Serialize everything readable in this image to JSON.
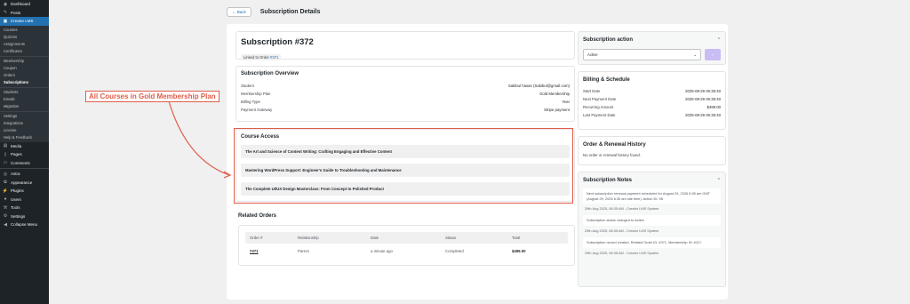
{
  "sidebar": {
    "top": [
      {
        "label": "Dashboard",
        "icon": "dashboard-icon"
      },
      {
        "label": "Posts",
        "icon": "pin-icon"
      },
      {
        "label": "Creator LMS",
        "icon": "lms-icon"
      }
    ],
    "lms_sub": [
      {
        "label": "Courses"
      },
      {
        "label": "Quizzes"
      },
      {
        "label": "Assignments"
      },
      {
        "label": "Certificates"
      },
      {
        "label": "Membership"
      },
      {
        "label": "Coupon"
      },
      {
        "label": "Orders"
      },
      {
        "label": "Subscriptions"
      },
      {
        "label": "Students"
      },
      {
        "label": "Emails"
      },
      {
        "label": "Migration"
      },
      {
        "label": "Settings"
      },
      {
        "label": "Integrations"
      },
      {
        "label": "License"
      },
      {
        "label": "Help & Feedback"
      }
    ],
    "bottom": [
      {
        "label": "Media",
        "icon": "media-icon"
      },
      {
        "label": "Pages",
        "icon": "pages-icon"
      },
      {
        "label": "Comments",
        "icon": "comments-icon"
      },
      {
        "label": "Astra",
        "icon": "astra-icon"
      },
      {
        "label": "Appearance",
        "icon": "appearance-icon"
      },
      {
        "label": "Plugins",
        "icon": "plugins-icon"
      },
      {
        "label": "Users",
        "icon": "users-icon"
      },
      {
        "label": "Tools",
        "icon": "tools-icon"
      },
      {
        "label": "Settings",
        "icon": "settings-icon"
      },
      {
        "label": "Collapse Menu",
        "icon": "collapse-icon"
      }
    ]
  },
  "header": {
    "back": "← Back",
    "title": "Subscription Details"
  },
  "subscription": {
    "title": "Subscription #372",
    "linked_prefix": "Linked to Order",
    "linked_order": "#371"
  },
  "overview": {
    "title": "Subscription Overview",
    "rows": [
      {
        "label": "Student",
        "value": "Sakibul hasan (Sakibul@gmail.com)"
      },
      {
        "label": "Membership Plan",
        "value": "Gold Membership"
      },
      {
        "label": "Billing Type",
        "value": "Year"
      },
      {
        "label": "Payment Gateway",
        "value": "Stripe payment"
      }
    ]
  },
  "course_access": {
    "title": "Course Access",
    "items": [
      "The Art and Science of Content Writing: Crafting Engaging and Effective Content",
      "Mastering WordPress Support: Engineer's Guide to Troubleshooting and Maintenance",
      "The Complete UI/UX Design Masterclass: From Concept to Polished Product"
    ]
  },
  "related_orders": {
    "title": "Related Orders",
    "headers": [
      "Order #",
      "Relationship",
      "Date",
      "Status",
      "Total"
    ],
    "rows": [
      {
        "order": "#371",
        "relationship": "Parent",
        "date": "a minute ago",
        "status": "Completed",
        "total": "$499.00"
      }
    ]
  },
  "subscription_action": {
    "title": "Subscription action",
    "selected": "Active",
    "button_icon": "chevron-right-icon"
  },
  "billing": {
    "title": "Billing & Schedule",
    "rows": [
      {
        "label": "Start Date",
        "value": "2025-08-29 06:35:40"
      },
      {
        "label": "Next Payment Date",
        "value": "2026-08-29 06:35:40"
      },
      {
        "label": "Recurring Amount",
        "value": "$499.00"
      },
      {
        "label": "Last Payment Date",
        "value": "2025-08-29 06:35:40"
      }
    ]
  },
  "history": {
    "title": "Order & Renewal History",
    "empty": "No order or renewal history found."
  },
  "notes": {
    "title": "Subscription Notes",
    "items": [
      {
        "text": "Next subscription renewal payment scheduled for August 29, 2026 6:35 am GMT (August 29, 2026 6:35 am site time). Action ID: 98",
        "meta": "29th Aug 2025, 06:35 AM - Creator LMS System"
      },
      {
        "text": "Subscription status changed to Active.",
        "meta": "29th Aug 2025, 06:35 AM - Creator LMS System"
      },
      {
        "text": "Subscription record created. Related Order ID: #371, Membership ID: #117.",
        "meta": "29th Aug 2025, 06:35 AM - Creator LMS System"
      }
    ]
  },
  "annotation": {
    "label": "All Courses in Gold Membership Plan"
  },
  "colors": {
    "accent": "#2271b1",
    "annotation": "#e05d49",
    "sidebar": "#1d2327"
  }
}
